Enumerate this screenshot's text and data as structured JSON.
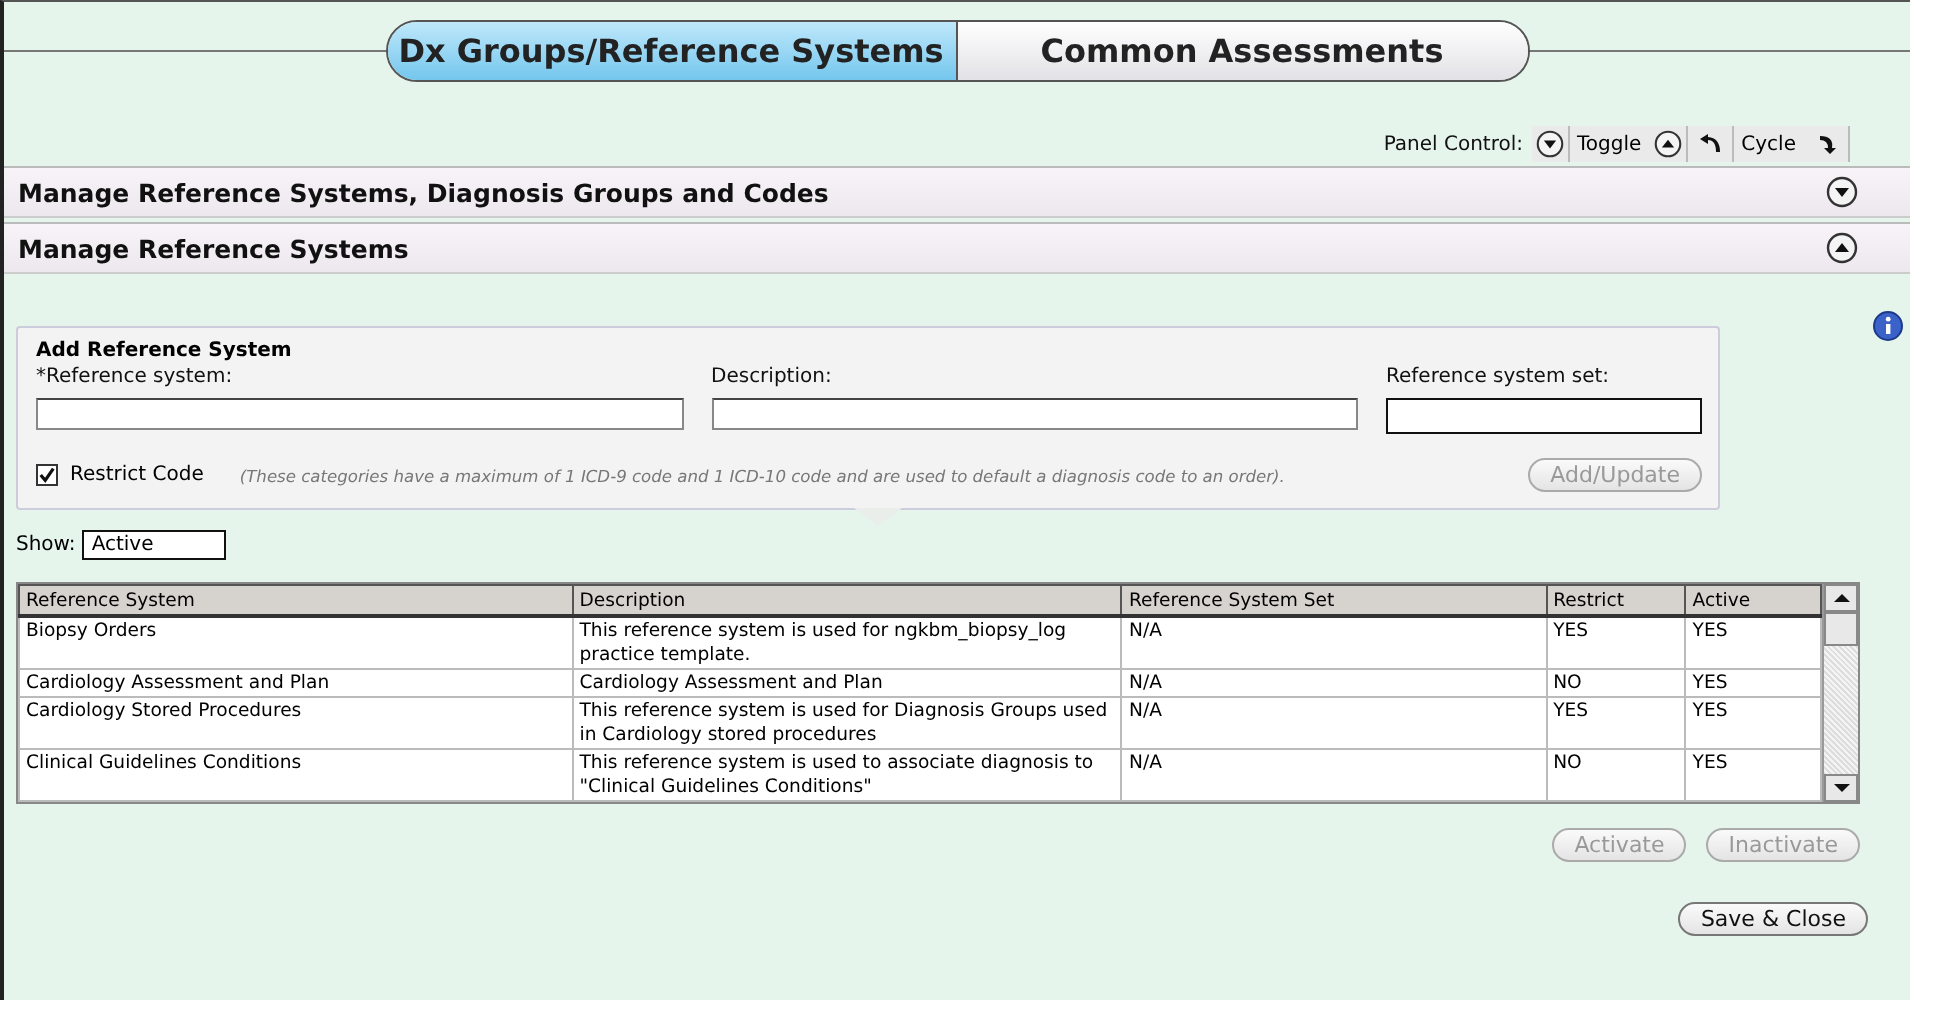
{
  "tabs": [
    {
      "label": "Dx Groups/Reference Systems",
      "selected": true
    },
    {
      "label": "Common Assessments",
      "selected": false
    }
  ],
  "panel_control": {
    "label": "Panel Control:",
    "toggle": "Toggle",
    "cycle": "Cycle"
  },
  "sections": [
    {
      "title": "Manage Reference Systems, Diagnosis Groups and Codes",
      "expanded": false
    },
    {
      "title": "Manage Reference Systems",
      "expanded": true
    }
  ],
  "form": {
    "title": "Add Reference System",
    "fields": [
      {
        "label": "*Reference system:"
      },
      {
        "label": "Description:"
      },
      {
        "label": "Reference system set:"
      }
    ],
    "restrict": {
      "label": "Restrict Code",
      "checked": true
    },
    "note": "(These categories have a maximum of 1 ICD-9 code and 1 ICD-10 code and are used to default a diagnosis code to an order).",
    "button": {
      "label": "Add/Update",
      "disabled": true
    }
  },
  "show": {
    "label": "Show:",
    "value": "Active"
  },
  "table": {
    "columns": [
      "Reference System",
      "Description",
      "Reference System Set",
      "Restrict",
      "Active"
    ],
    "rows": [
      [
        "Biopsy Orders",
        "This reference system is used for ngkbm_biopsy_log practice template.",
        "N/A",
        "YES",
        "YES"
      ],
      [
        "Cardiology Assessment and Plan",
        "Cardiology Assessment and Plan",
        "N/A",
        "NO",
        "YES"
      ],
      [
        "Cardiology Stored Procedures",
        "This reference system is used for Diagnosis Groups used in Cardiology stored procedures",
        "N/A",
        "YES",
        "YES"
      ],
      [
        "Clinical Guidelines Conditions",
        "This reference system is used to associate diagnosis to \"Clinical Guidelines Conditions\"",
        "N/A",
        "NO",
        "YES"
      ]
    ]
  },
  "actions": [
    {
      "label": "Activate",
      "disabled": true
    },
    {
      "label": "Inactivate",
      "disabled": true
    }
  ],
  "save": {
    "label": "Save & Close",
    "disabled": false
  }
}
